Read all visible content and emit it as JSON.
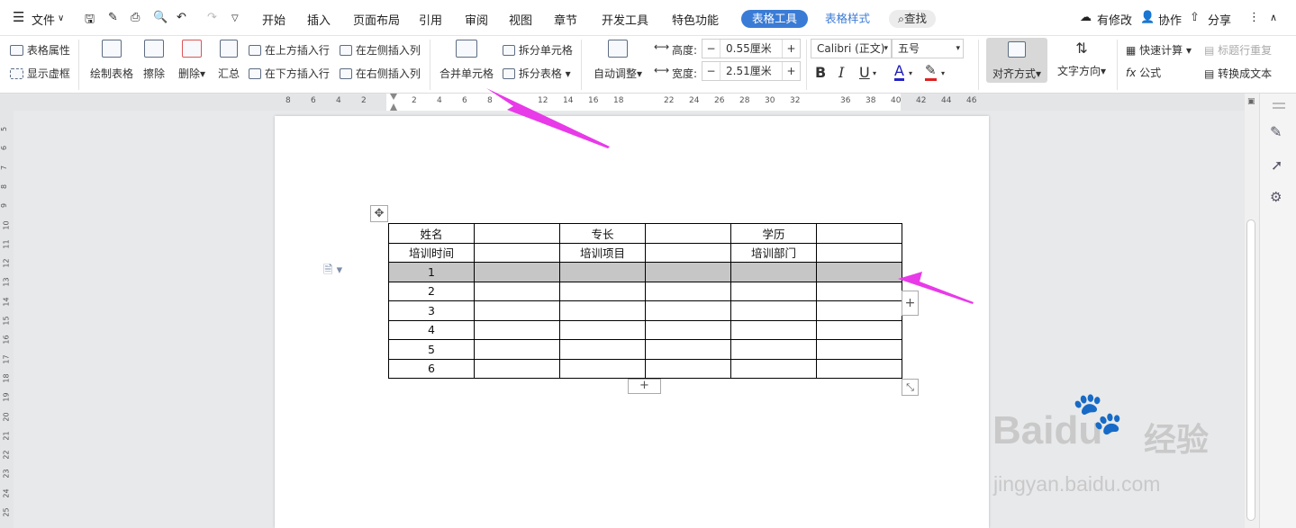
{
  "menubar": {
    "file": "文件",
    "tabs": [
      "开始",
      "插入",
      "页面布局",
      "引用",
      "审阅",
      "视图",
      "章节",
      "开发工具",
      "特色功能"
    ],
    "active_tab": "表格工具",
    "second_tab": "表格样式",
    "search": "查找",
    "right": {
      "modified": "有修改",
      "collab": "协作",
      "share": "分享"
    }
  },
  "ribbon": {
    "table_props": "表格属性",
    "show_grid": "显示虚框",
    "draw_table": "绘制表格",
    "erase": "擦除",
    "delete": "删除",
    "summary": "汇总",
    "insert_above": "在上方插入行",
    "insert_below": "在下方插入行",
    "insert_left": "在左侧插入列",
    "insert_right": "在右侧插入列",
    "merge_cells": "合并单元格",
    "split_cells": "拆分单元格",
    "split_table": "拆分表格",
    "auto_fit": "自动调整",
    "height_label": "高度:",
    "height_value": "0.55厘米",
    "width_label": "宽度:",
    "width_value": "2.51厘米",
    "font_name": "Calibri (正文)",
    "font_size": "五号",
    "bold": "B",
    "italic": "I",
    "underline": "U",
    "font_color": "A",
    "align": "对齐方式",
    "text_dir": "文字方向",
    "quick_calc": "快速计算",
    "header_repeat": "标题行重复",
    "formula": "公式",
    "to_text": "转换成文本"
  },
  "ruler": {
    "h_ticks": [
      "8",
      "6",
      "4",
      "2",
      "2",
      "4",
      "6",
      "8",
      "12",
      "14",
      "16",
      "18",
      "22",
      "24",
      "26",
      "28",
      "30",
      "32",
      "36",
      "38",
      "40",
      "42",
      "44",
      "46"
    ],
    "v_ticks": [
      "5",
      "6",
      "7",
      "8",
      "9",
      "10",
      "11",
      "12",
      "13",
      "14",
      "15",
      "16",
      "17",
      "18",
      "19",
      "20",
      "21",
      "22",
      "23",
      "24",
      "25"
    ]
  },
  "table": {
    "rows": [
      [
        "姓名",
        "",
        "专长",
        "",
        "学历",
        ""
      ],
      [
        "培训时间",
        "",
        "培训项目",
        "",
        "培训部门",
        ""
      ],
      [
        "1",
        "",
        "",
        "",
        "",
        ""
      ],
      [
        "2",
        "",
        "",
        "",
        "",
        ""
      ],
      [
        "3",
        "",
        "",
        "",
        "",
        ""
      ],
      [
        "4",
        "",
        "",
        "",
        "",
        ""
      ],
      [
        "5",
        "",
        "",
        "",
        "",
        ""
      ],
      [
        "6",
        "",
        "",
        "",
        "",
        ""
      ]
    ],
    "selected_row": 2
  },
  "watermark": {
    "brand": "Baidu",
    "brand_cn": "经验",
    "url": "jingyan.baidu.com"
  },
  "colors": {
    "accent": "#3a7bd5",
    "arrow": "#e83ae8",
    "selected": "#c6c6c6"
  }
}
